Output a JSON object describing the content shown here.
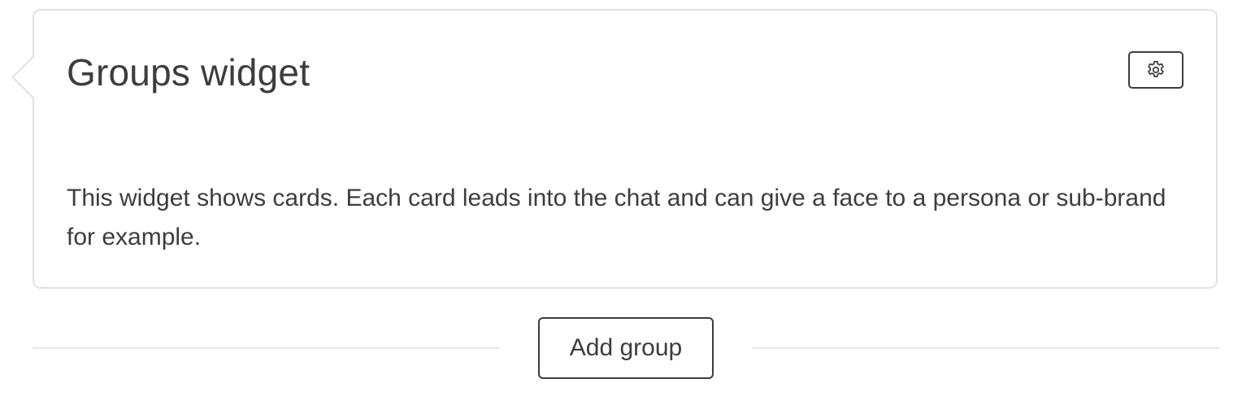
{
  "widget": {
    "title": "Groups widget",
    "description": "This widget shows cards. Each card leads into the chat and can give a face to a persona or sub-brand for example.",
    "settings_icon": "gear-icon"
  },
  "footer": {
    "add_group_label": "Add group"
  },
  "colors": {
    "text": "#3d3d3d",
    "border": "#e2e2e2",
    "divider": "#e6e6e6",
    "background": "#ffffff"
  }
}
